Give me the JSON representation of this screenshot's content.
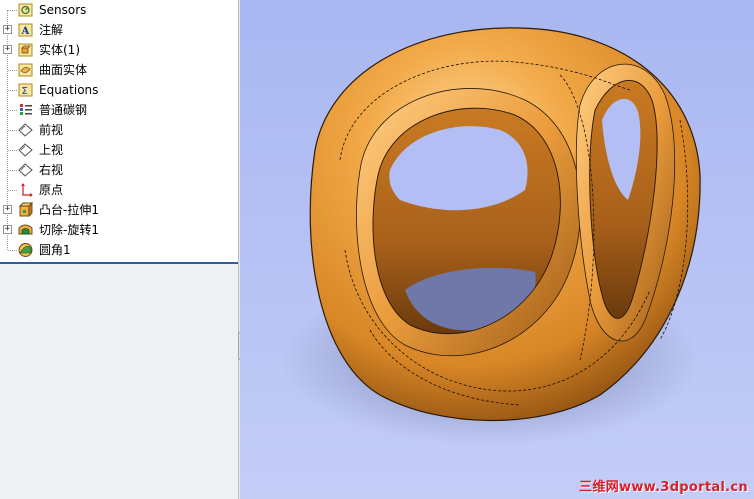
{
  "feature_tree": {
    "items": [
      {
        "label": "Sensors",
        "icon": "sensor-icon",
        "expandable": false
      },
      {
        "label": "注解",
        "icon": "annotation-icon",
        "expandable": true
      },
      {
        "label": "实体(1)",
        "icon": "solid-bodies-icon",
        "expandable": true
      },
      {
        "label": "曲面实体",
        "icon": "surface-bodies-icon",
        "expandable": false
      },
      {
        "label": "Equations",
        "icon": "equations-icon",
        "expandable": false
      },
      {
        "label": "普通碳钢",
        "icon": "material-icon",
        "expandable": false
      },
      {
        "label": "前视",
        "icon": "plane-icon",
        "expandable": false
      },
      {
        "label": "上视",
        "icon": "plane-icon",
        "expandable": false
      },
      {
        "label": "右视",
        "icon": "plane-icon",
        "expandable": false
      },
      {
        "label": "原点",
        "icon": "origin-icon",
        "expandable": false
      },
      {
        "label": "凸台-拉伸1",
        "icon": "extrude-icon",
        "expandable": true
      },
      {
        "label": "切除-旋转1",
        "icon": "cut-revolve-icon",
        "expandable": true
      },
      {
        "label": "圆角1",
        "icon": "fillet-icon",
        "expandable": false
      }
    ]
  },
  "colors": {
    "model_orange": "#e89a3a",
    "viewport_blue": "#aebaf3",
    "watermark_red": "#d8202c"
  },
  "watermark": {
    "text": "三维网www.3dportal.cn"
  }
}
